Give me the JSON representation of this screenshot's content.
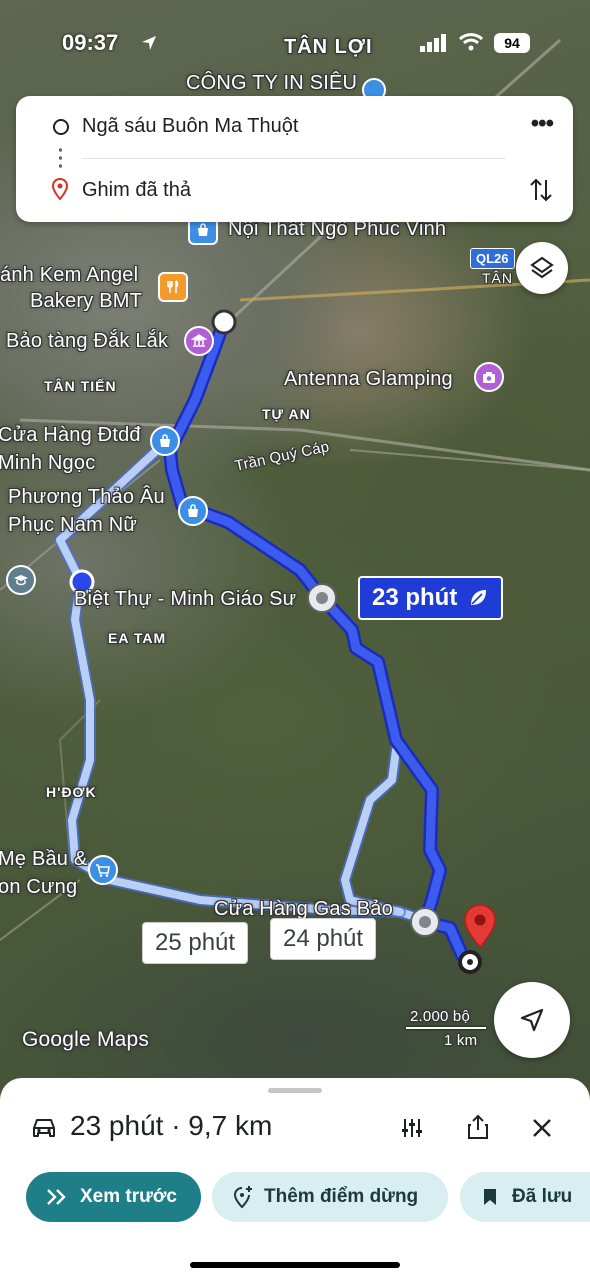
{
  "status_bar": {
    "time": "09:37",
    "battery": "94"
  },
  "directions": {
    "origin": "Ngã sáu Buôn Ma Thuột",
    "destination": "Ghim đã thả"
  },
  "map_labels": {
    "tan_loi": "TÂN LỢI",
    "cong_ty": "CÔNG TY IN SIÊU",
    "noi_that": "Nội Thất Ngô Phúc Vinh",
    "kem_angel": "ánh Kem Angel",
    "bakery": "Bakery BMT",
    "bao_tang": "Bảo tàng Đắk Lắk",
    "tan_tien": "TÂN TIẾN",
    "antenna": "Antenna Glamping",
    "tu_an": "TỰ AN",
    "tran_quy_cap": "Trần Quý Cáp",
    "cua_hang_dtdd": "Cửa Hàng Đtdđ",
    "minh_ngoc": "Minh Ngọc",
    "phuong_thao": "Phương Thảo Âu",
    "phuc_nam_nu": "Phục Nam Nữ",
    "biet_thu": "Biệt Thự - Minh Giáo Sư",
    "ea_tam": "EA TAM",
    "h_dok": "H'ĐƠK",
    "me_bau": "Mẹ Bầu &",
    "con_cung": "on Cưng",
    "cua_hang_gas": "Cửa Hàng Gas Bảo",
    "ql26": "QL26",
    "tan": "TÂN",
    "google_maps": "Google Maps",
    "scale_ft": "2.000 bộ",
    "scale_km": "1 km"
  },
  "routes": {
    "primary_time": "23 phút",
    "alt1_time": "25 phút",
    "alt2_time": "24 phút"
  },
  "bottom_sheet": {
    "summary": "23 phút · 9,7 km",
    "preview_button": "Xem trước",
    "add_stop_button": "Thêm điểm dừng",
    "saved_button": "Đã lưu"
  },
  "colors": {
    "route_primary": "#2a48e8",
    "route_alt": "#a9c4f5",
    "accent_teal": "#1f7f88",
    "chip_bg": "#d8eef1",
    "poi_purple": "#b15fd6",
    "poi_blue": "#3d8fe6",
    "poi_orange": "#f29b2c",
    "pin_red": "#e53935"
  }
}
